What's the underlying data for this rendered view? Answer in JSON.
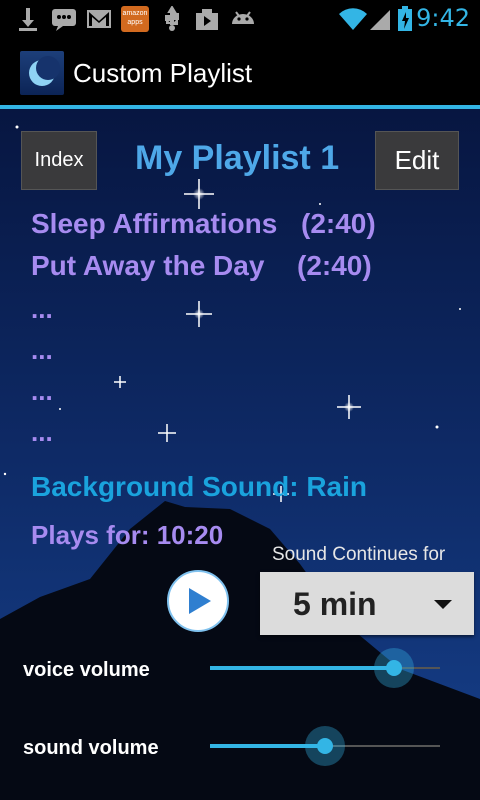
{
  "status_bar": {
    "time": "9:42",
    "icons": [
      "download-icon",
      "chat-icon",
      "gmail-icon",
      "amazon-appstore-icon",
      "usb-icon",
      "play-store-icon",
      "android-icon",
      "wifi-icon",
      "signal-icon",
      "battery-icon"
    ],
    "amazon_icon_text_1": "amazon",
    "amazon_icon_text_2": "apps"
  },
  "action_bar": {
    "title": "Custom Playlist",
    "icon": "moon-icon"
  },
  "playlist": {
    "index_button": "Index",
    "title": "My Playlist 1",
    "edit_button": "Edit",
    "tracks": [
      {
        "name": "Sleep Affirmations",
        "duration": "(2:40)"
      },
      {
        "name": "Put Away the Day",
        "duration": "(2:40)"
      }
    ],
    "placeholders": [
      "...",
      "...",
      "...",
      "..."
    ],
    "background_sound": "Background Sound:  Rain",
    "plays_for": "Plays for:  10:20"
  },
  "controls": {
    "continues_label": "Sound Continues for",
    "continue_value": "5 min",
    "play_icon": "play-icon"
  },
  "volumes": {
    "voice_label": "voice volume",
    "voice_level": 0.8,
    "sound_label": "sound volume",
    "sound_level": 0.5
  },
  "colors": {
    "accent": "#33b5e5",
    "track_text": "#a78bf0",
    "title_text": "#4ea8e8",
    "background_sound_text": "#1aa3dd"
  }
}
